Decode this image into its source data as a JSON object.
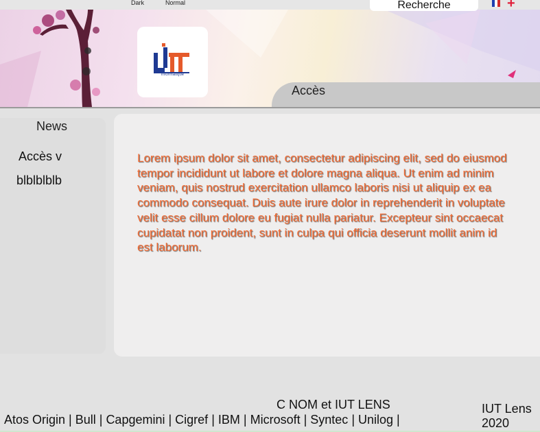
{
  "topbar": {
    "theme_dark": "Dark",
    "theme_normal": "Normal",
    "search_label": "Recherche"
  },
  "banner": {
    "logo_text": "informatique",
    "access_label": "Accès"
  },
  "sidebar": {
    "title": "News",
    "items": [
      {
        "label": "Accès v"
      },
      {
        "label": "blblblblb"
      }
    ]
  },
  "main": {
    "paragraph": "Lorem ipsum dolor sit amet, consectetur adipiscing elit, sed do eiusmod tempor incididunt ut labore et dolore magna aliqua. Ut enim ad minim veniam, quis nostrud exercitation ullamco laboris nisi ut aliquip ex ea commodo consequat. Duis aute irure dolor in reprehenderit in voluptate velit esse cillum dolore eu fugiat nulla pariatur. Excepteur sint occaecat cupidatat non proident, sunt in culpa qui officia deserunt mollit anim id est laborum."
  },
  "footer": {
    "copyright": "C NOM et IUT LENS",
    "partners": [
      "Atos Origin",
      "Bull",
      "Capgemini",
      "Cigref",
      "IBM",
      "Microsoft",
      "Syntec",
      "Unilog"
    ],
    "separator": " | ",
    "year_line1": "IUT Lens",
    "year_line2": "2020"
  },
  "colors": {
    "accent_text": "#f26a32",
    "logo_blue": "#1f3a93",
    "logo_orange": "#e55a2b"
  }
}
